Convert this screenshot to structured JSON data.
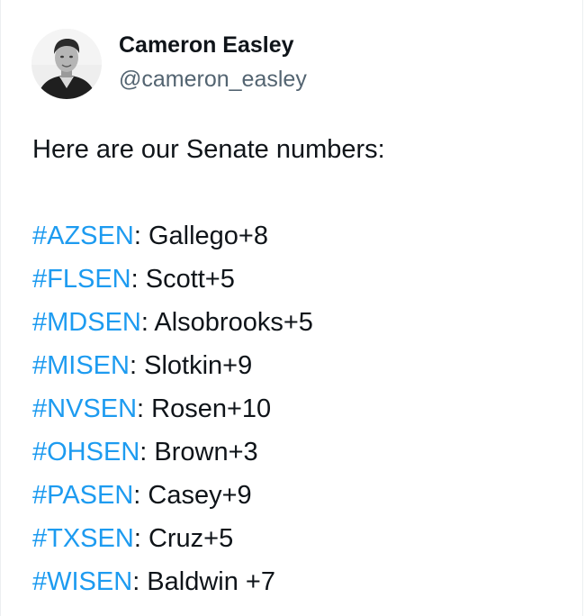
{
  "author": {
    "display_name": "Cameron Easley",
    "handle": "@cameron_easley"
  },
  "tweet": {
    "intro": "Here are our Senate numbers:",
    "lines": [
      {
        "hashtag": "#AZSEN",
        "rest": ": Gallego+8"
      },
      {
        "hashtag": "#FLSEN",
        "rest": ": Scott+5"
      },
      {
        "hashtag": "#MDSEN",
        "rest": ": Alsobrooks+5"
      },
      {
        "hashtag": "#MISEN",
        "rest": ": Slotkin+9"
      },
      {
        "hashtag": "#NVSEN",
        "rest": ": Rosen+10"
      },
      {
        "hashtag": "#OHSEN",
        "rest": ": Brown+3"
      },
      {
        "hashtag": "#PASEN",
        "rest": ": Casey+9"
      },
      {
        "hashtag": "#TXSEN",
        "rest": ": Cruz+5"
      },
      {
        "hashtag": "#WISEN",
        "rest": ": Baldwin +7"
      }
    ]
  },
  "colors": {
    "hashtag": "#1d9bf0",
    "text": "#0f1419",
    "handle": "#536471"
  }
}
